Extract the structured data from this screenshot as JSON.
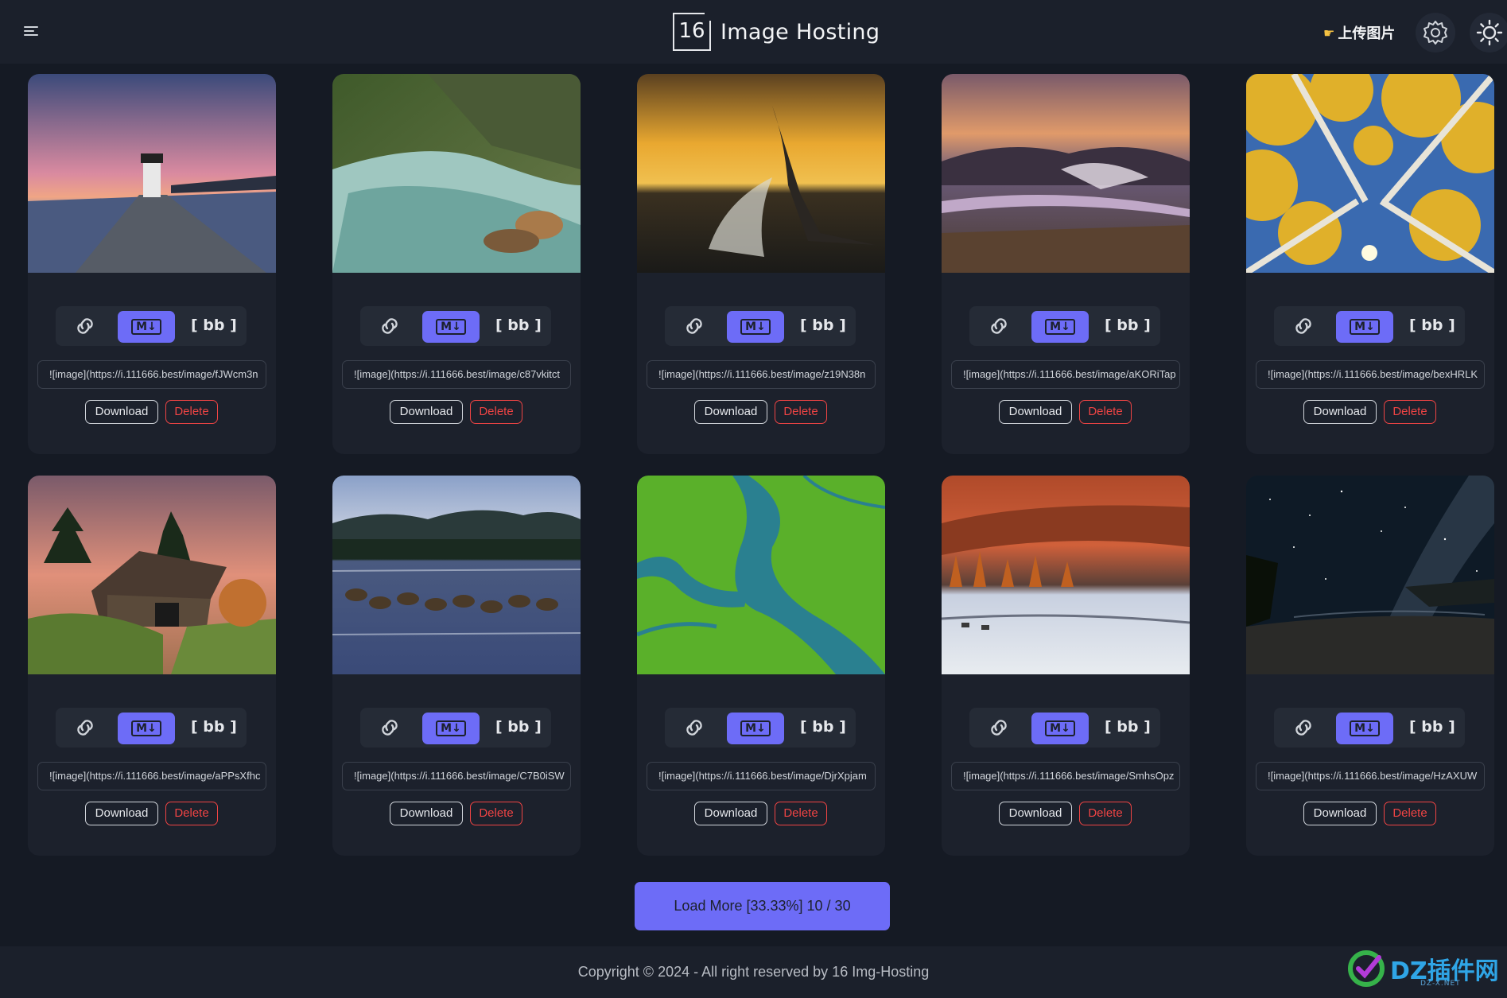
{
  "header": {
    "logo_number": "16",
    "title": "Image Hosting",
    "upload_label": "上传图片",
    "upload_icon": "pointing-hand-icon",
    "settings_icon": "gear-icon",
    "theme_icon": "sun-icon"
  },
  "cards": [
    {
      "url": "![image](https://i.111666.best/image/fJWcm3n",
      "download": "Download",
      "delete": "Delete",
      "bb": "[ bb ]",
      "md": "M↓",
      "scene": "lighthouse"
    },
    {
      "url": "![image](https://i.111666.best/image/c87vkitct",
      "download": "Download",
      "delete": "Delete",
      "bb": "[ bb ]",
      "md": "M↓",
      "scene": "stream"
    },
    {
      "url": "![image](https://i.111666.best/image/z19N38n",
      "download": "Download",
      "delete": "Delete",
      "bb": "[ bb ]",
      "md": "M↓",
      "scene": "whale-tail"
    },
    {
      "url": "![image](https://i.111666.best/image/aKORiTap",
      "download": "Download",
      "delete": "Delete",
      "bb": "[ bb ]",
      "md": "M↓",
      "scene": "geyser-basin"
    },
    {
      "url": "![image](https://i.111666.best/image/bexHRLK",
      "download": "Download",
      "delete": "Delete",
      "bb": "[ bb ]",
      "md": "M↓",
      "scene": "aspen-trees"
    },
    {
      "url": "![image](https://i.111666.best/image/aPPsXfhc",
      "download": "Download",
      "delete": "Delete",
      "bb": "[ bb ]",
      "md": "M↓",
      "scene": "covered-bridge"
    },
    {
      "url": "![image](https://i.111666.best/image/C7B0iSW",
      "download": "Download",
      "delete": "Delete",
      "bb": "[ bb ]",
      "md": "M↓",
      "scene": "sea-otters"
    },
    {
      "url": "![image](https://i.111666.best/image/DjrXpjam",
      "download": "Download",
      "delete": "Delete",
      "bb": "[ bb ]",
      "md": "M↓",
      "scene": "river-delta"
    },
    {
      "url": "![image](https://i.111666.best/image/SmhsOpz",
      "download": "Download",
      "delete": "Delete",
      "bb": "[ bb ]",
      "md": "M↓",
      "scene": "tundra-caribou"
    },
    {
      "url": "![image](https://i.111666.best/image/HzAXUW",
      "download": "Download",
      "delete": "Delete",
      "bb": "[ bb ]",
      "md": "M↓",
      "scene": "milky-way"
    }
  ],
  "load_more": {
    "label": "Load More [33.33%] 10 / 30",
    "loaded": 10,
    "total": 30,
    "percent": 33.33
  },
  "footer": {
    "copyright": "Copyright © 2024 - All right reserved by 16 Img-Hosting"
  },
  "watermark": {
    "text": "DZ插件网",
    "sub": "DZ-X.NET"
  },
  "colors": {
    "accent": "#6d6cf7",
    "danger": "#ef4444",
    "background": "#151a24",
    "card": "#1c212c"
  }
}
